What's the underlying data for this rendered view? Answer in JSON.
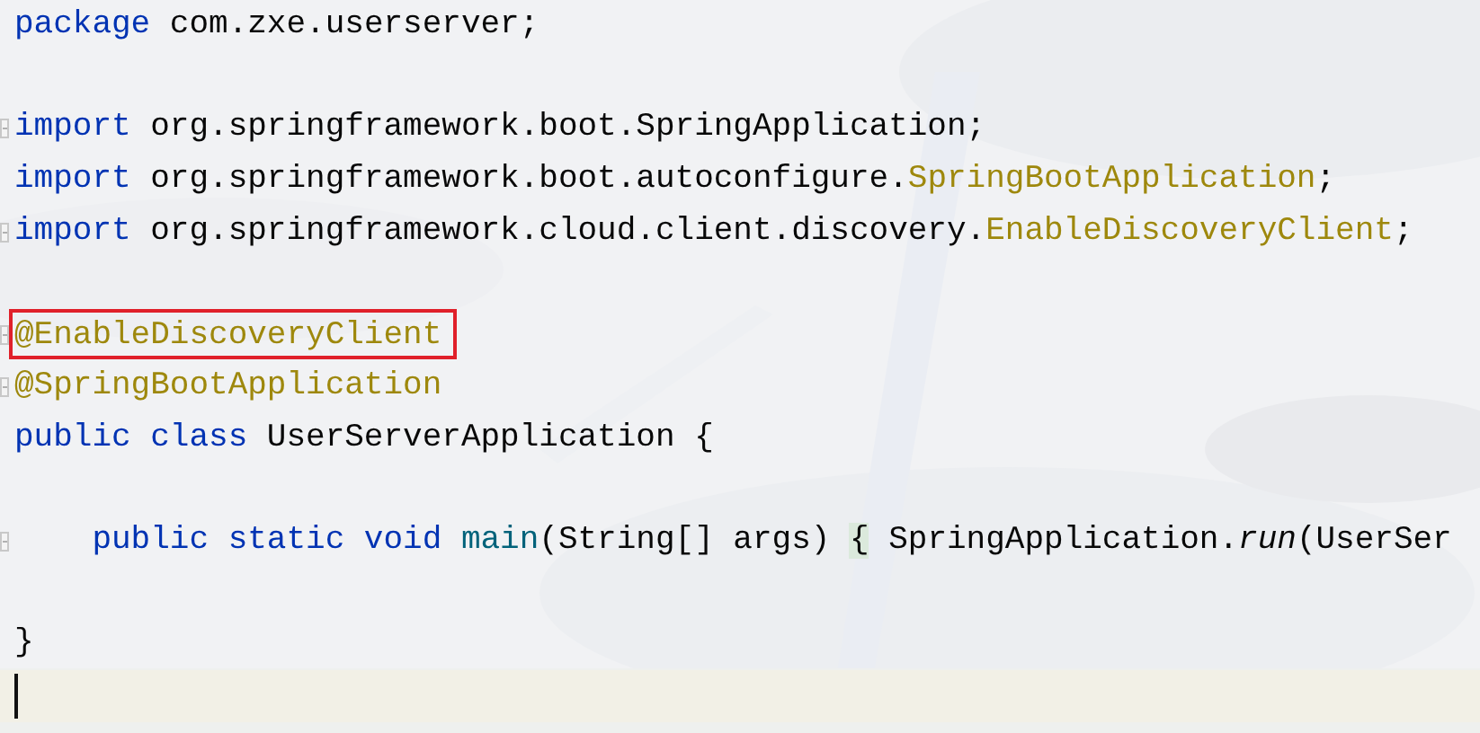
{
  "editor": {
    "lines": [
      {
        "kind": "code",
        "tokens": [
          {
            "kind": "keyword",
            "text": "package"
          },
          {
            "kind": "plain",
            "text": " com.zxe.userserver;"
          }
        ]
      },
      {
        "kind": "blank"
      },
      {
        "kind": "code",
        "tokens": [
          {
            "kind": "fold"
          },
          {
            "kind": "keyword",
            "text": "import"
          },
          {
            "kind": "plain",
            "text": " org.springframework.boot.SpringApplication;"
          }
        ]
      },
      {
        "kind": "code",
        "tokens": [
          {
            "kind": "keyword",
            "text": "import"
          },
          {
            "kind": "plain",
            "text": " org.springframework.boot.autoconfigure."
          },
          {
            "kind": "annotation",
            "text": "SpringBootApplication"
          },
          {
            "kind": "plain",
            "text": ";"
          }
        ]
      },
      {
        "kind": "code",
        "tokens": [
          {
            "kind": "fold"
          },
          {
            "kind": "keyword",
            "text": "import"
          },
          {
            "kind": "plain",
            "text": " org.springframework.cloud.client.discovery."
          },
          {
            "kind": "annotation",
            "text": "EnableDiscoveryClient"
          },
          {
            "kind": "plain",
            "text": ";"
          }
        ]
      },
      {
        "kind": "blank"
      },
      {
        "kind": "code",
        "tokens": [
          {
            "kind": "fold"
          },
          {
            "kind": "boxed_annotation",
            "text": "@EnableDiscoveryClient"
          }
        ]
      },
      {
        "kind": "code",
        "tokens": [
          {
            "kind": "fold"
          },
          {
            "kind": "annotation",
            "text": "@SpringBootApplication"
          }
        ]
      },
      {
        "kind": "code",
        "tokens": [
          {
            "kind": "keyword",
            "text": "public class"
          },
          {
            "kind": "plain",
            "text": " UserServerApplication {"
          }
        ]
      },
      {
        "kind": "blank"
      },
      {
        "kind": "code",
        "tokens": [
          {
            "kind": "fold"
          },
          {
            "kind": "keyword",
            "text": "    public static void"
          },
          {
            "kind": "method",
            "text": " main"
          },
          {
            "kind": "plain",
            "text": "(String[] args) "
          },
          {
            "kind": "brace_match",
            "text": "{"
          },
          {
            "kind": "plain",
            "text": " SpringApplication."
          },
          {
            "kind": "static_call",
            "text": "run"
          },
          {
            "kind": "plain",
            "text": "(UserSer"
          }
        ]
      },
      {
        "kind": "blank"
      },
      {
        "kind": "code",
        "tokens": [
          {
            "kind": "plain",
            "text": "}"
          }
        ]
      },
      {
        "kind": "cursor"
      }
    ]
  }
}
